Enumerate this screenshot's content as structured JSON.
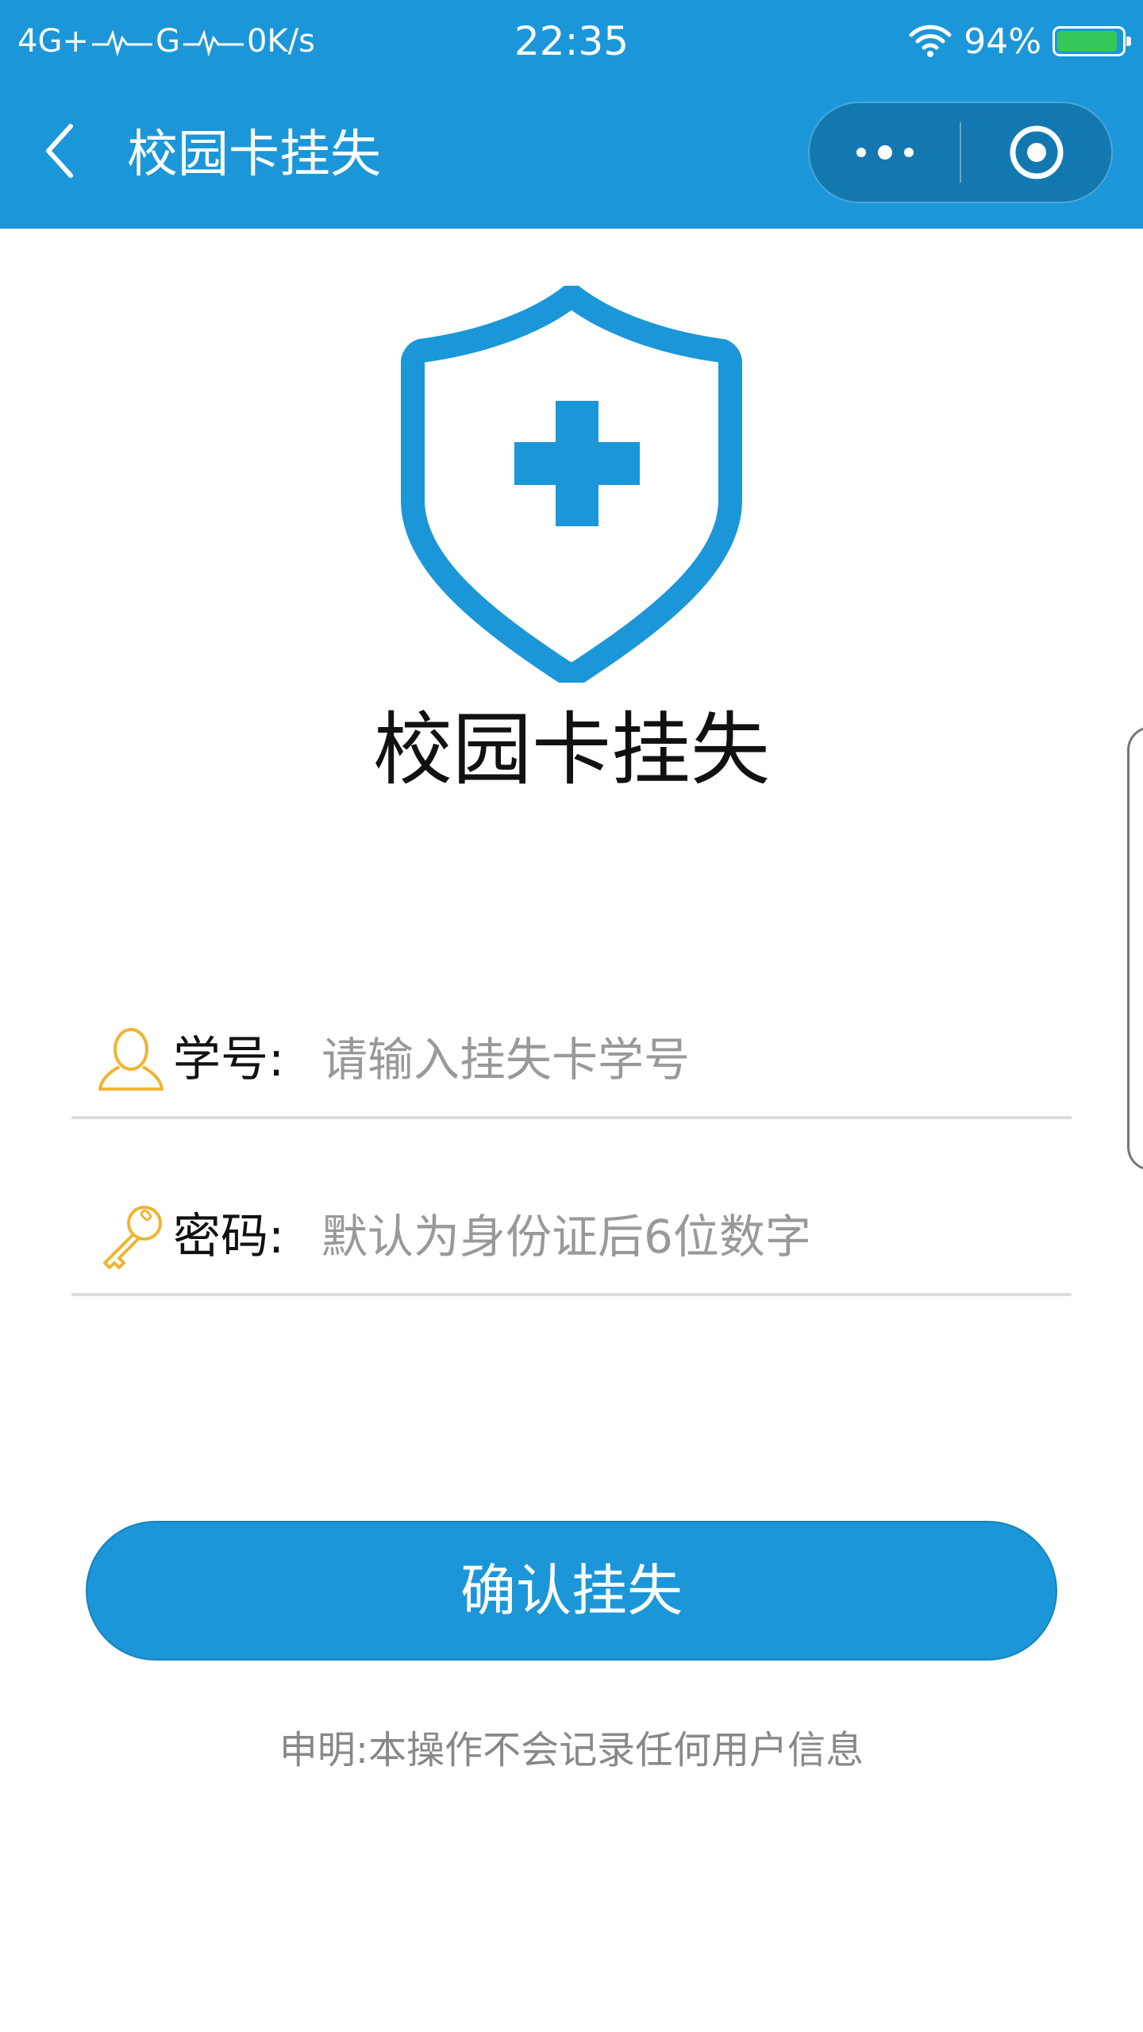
{
  "status_bar": {
    "network_1": "4G+",
    "network_2": "G",
    "speed": "0K/s",
    "time": "22:35",
    "battery_percent": "94%",
    "battery_level": 0.94
  },
  "nav": {
    "title": "校园卡挂失"
  },
  "main": {
    "title": "校园卡挂失",
    "student_id": {
      "label": "学号:",
      "placeholder": "请输入挂失卡学号",
      "value": ""
    },
    "password": {
      "label": "密码:",
      "placeholder": "默认为身份证后6位数字",
      "value": ""
    },
    "confirm_label": "确认挂失",
    "disclaimer": "申明:本操作不会记录任何用户信息"
  },
  "colors": {
    "primary": "#1b97d9",
    "capsule": "#1478b0",
    "icon_yellow": "#f0b432",
    "battery_green": "#35c759"
  },
  "icons": {
    "back": "chevron-left-icon",
    "more": "more-dots-icon",
    "close": "target-circle-icon",
    "shield": "shield-plus-icon",
    "user": "user-outline-icon",
    "key": "key-icon",
    "wifi": "wifi-icon",
    "battery": "battery-icon"
  }
}
